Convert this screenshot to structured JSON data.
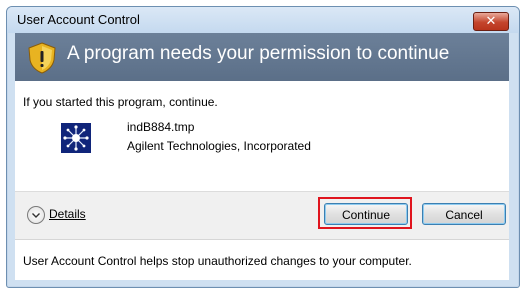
{
  "window": {
    "title": "User Account Control",
    "close_label": "✕"
  },
  "banner": {
    "message": "A program needs your permission to continue",
    "icon": "shield-warning-icon"
  },
  "content": {
    "prompt": "If you started this program, continue.",
    "program_name": "indB884.tmp",
    "publisher": "Agilent Technologies, Incorporated",
    "program_icon": "agilent-logo-icon"
  },
  "actions": {
    "details_label": "Details",
    "continue_label": "Continue",
    "cancel_label": "Cancel"
  },
  "footer": {
    "text": "User Account Control helps stop unauthorized changes to your computer."
  },
  "colors": {
    "banner": "#5b6f88",
    "highlight": "#e0141e",
    "close_button": "#c4452c"
  }
}
